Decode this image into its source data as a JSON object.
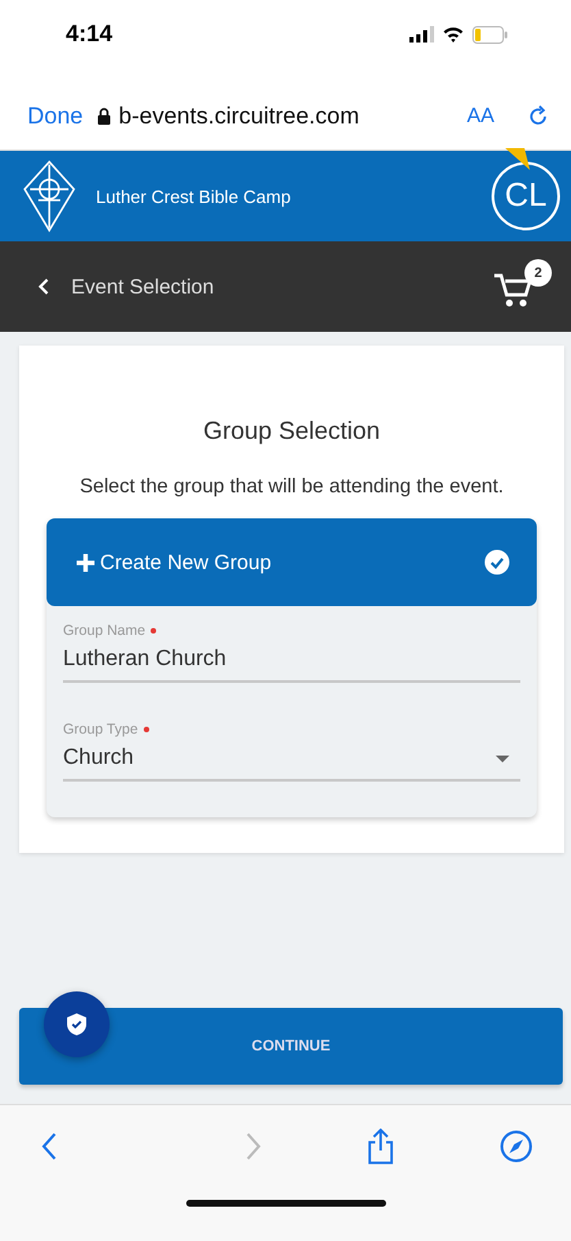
{
  "status_bar": {
    "time": "4:14"
  },
  "browser": {
    "done": "Done",
    "url": "b-events.circuitree.com",
    "text_size": "AA"
  },
  "header": {
    "camp_name": "Luther Crest Bible Camp",
    "avatar_initials": "CL"
  },
  "nav": {
    "back_label": "Event Selection",
    "cart_count": "2"
  },
  "card": {
    "title": "Group Selection",
    "description": "Select the group that will be attending the event.",
    "group_option": {
      "label": "Create New Group",
      "selected": true
    },
    "fields": [
      {
        "kind": "text",
        "label": "Group Name",
        "required": true,
        "value": "Lutheran Church"
      },
      {
        "kind": "select",
        "label": "Group Type",
        "required": true,
        "value": "Church"
      }
    ]
  },
  "continue_button": "CONTINUE",
  "toolbar": {
    "back_enabled": true,
    "forward_enabled": false
  }
}
